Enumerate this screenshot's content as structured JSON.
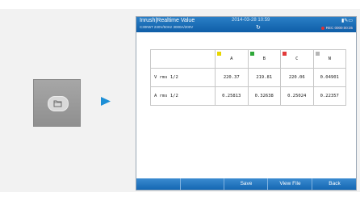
{
  "device": {
    "title": "Inrush|Realtime Value",
    "datetime": "2014-03-28 10:59",
    "subtitle": "C30N5T  230V/50Hz  3000A/200V",
    "record_indicator": "REC 0000:00:35"
  },
  "table": {
    "headers": [
      "",
      "A",
      "B",
      "C",
      "N"
    ],
    "swatch_colors": [
      "#e8d600",
      "#2fa83a",
      "#e23a3a",
      "#b5b5b5"
    ],
    "rows": [
      {
        "label": "V rms 1/2",
        "values": [
          "220.37",
          "219.81",
          "220.06",
          "0.04901"
        ]
      },
      {
        "label": "A rms 1/2",
        "values": [
          "0.25813",
          "0.32638",
          "0.25024",
          "0.22357"
        ]
      }
    ]
  },
  "softkeys": [
    "",
    "",
    "Save",
    "View File",
    "Back"
  ],
  "colors": {
    "titlebar": "#1769b5",
    "arrow": "#1d8fd6"
  },
  "icons": {
    "open_file": "folder-icon",
    "arrow": "arrow-right-icon",
    "refresh": "refresh-icon"
  }
}
